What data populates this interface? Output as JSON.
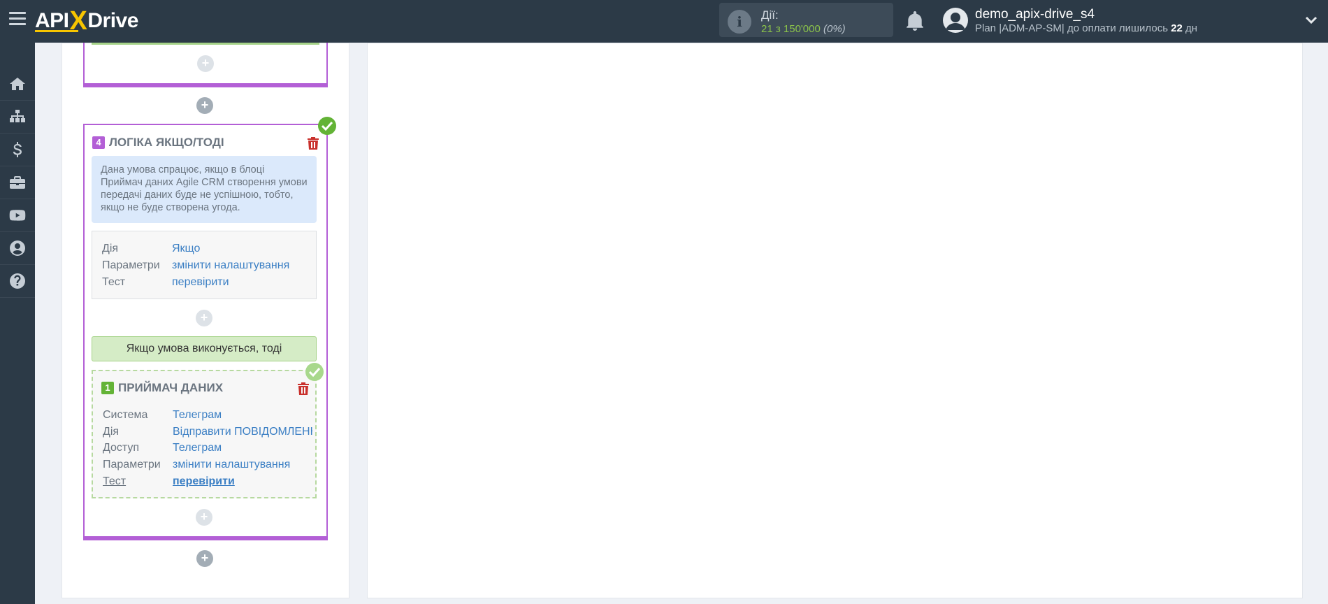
{
  "header": {
    "logo": {
      "api": "API",
      "x": "X",
      "drive": "Drive"
    },
    "actions": {
      "label": "Дії:",
      "value": "21 з 150'000",
      "percent": "(0%)"
    },
    "user": {
      "name": "demo_apix-drive_s4",
      "plan_prefix": "Plan |ADM-AP-SM| до оплати лишилось ",
      "days": "22",
      "days_suffix": " дн"
    }
  },
  "sidebar": {
    "items": [
      {
        "icon": "home-icon"
      },
      {
        "icon": "sitemap-icon"
      },
      {
        "icon": "dollar-icon"
      },
      {
        "icon": "briefcase-icon"
      },
      {
        "icon": "youtube-icon"
      },
      {
        "icon": "user-circle-icon"
      },
      {
        "icon": "question-icon"
      }
    ]
  },
  "logic_block": {
    "number": "4",
    "title": "ЛОГІКА ЯКЩО/ТОДІ",
    "description": "Дана умова спрацює, якщо в блоці Приймач даних Agile CRM створення умови передачі даних буде не успішною, тобто, якщо не буде створена угода.",
    "params": [
      {
        "key": "Дія",
        "value": "Якщо"
      },
      {
        "key": "Параметри",
        "value": "змінити налаштування"
      },
      {
        "key": "Тест",
        "value": "перевірити"
      }
    ],
    "condition_label": "Якщо умова виконується, тоді"
  },
  "receiver_block": {
    "number": "1",
    "title": "ПРИЙМАЧ ДАНИХ",
    "params": [
      {
        "key": "Система",
        "value": "Телеграм"
      },
      {
        "key": "Дія",
        "value": "Відправити ПОВІДОМЛЕННЯ"
      },
      {
        "key": "Доступ",
        "value": "Телеграм"
      },
      {
        "key": "Параметри",
        "value": "змінити налаштування"
      },
      {
        "key": "Тест",
        "value": "перевірити"
      }
    ]
  },
  "colors": {
    "topbar": "#2c3a47",
    "purple": "#b35fd6",
    "green": "#63b336",
    "link": "#3b7fc4",
    "trash": "#c9302c"
  }
}
